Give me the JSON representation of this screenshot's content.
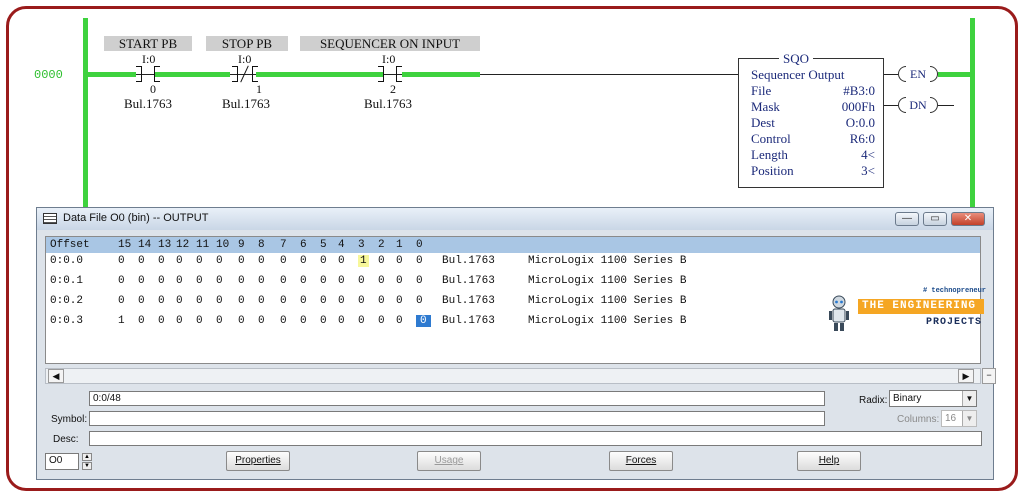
{
  "rung": {
    "number": "0000",
    "instructions": [
      {
        "title": "START PB",
        "address": "I:0",
        "bit": "0",
        "device": "Bul.1763"
      },
      {
        "title": "STOP PB",
        "address": "I:0",
        "bit": "1",
        "device": "Bul.1763"
      },
      {
        "title": "SEQUENCER ON INPUT",
        "address": "I:0",
        "bit": "2",
        "device": "Bul.1763"
      }
    ],
    "sqo": {
      "header": "SQO",
      "title": "Sequencer Output",
      "rows": [
        {
          "key": "File",
          "value": "#B3:0"
        },
        {
          "key": "Mask",
          "value": "000Fh"
        },
        {
          "key": "Dest",
          "value": "O:0.0"
        },
        {
          "key": "Control",
          "value": "R6:0"
        },
        {
          "key": "Length",
          "value": "4<"
        },
        {
          "key": "Position",
          "value": "3<"
        }
      ]
    },
    "coils": {
      "en": "EN",
      "dn": "DN"
    }
  },
  "window": {
    "title": "Data File O0 (bin)  --  OUTPUT",
    "controls": {
      "minimize": "—",
      "restore": "▭",
      "close": "✕"
    },
    "grid": {
      "columns": [
        "Offset",
        "15",
        "14",
        "13",
        "12",
        "11",
        "10",
        "9",
        "8",
        "7",
        "6",
        "5",
        "4",
        "3",
        "2",
        "1",
        "0"
      ],
      "rows": [
        {
          "offset": "0:0.0",
          "bits": [
            "0",
            "0",
            "0",
            "0",
            "0",
            "0",
            "0",
            "0",
            "0",
            "0",
            "0",
            "0",
            "1",
            "0",
            "0",
            "0"
          ],
          "device": "Bul.1763",
          "description": "MicroLogix 1100 Series B"
        },
        {
          "offset": "0:0.1",
          "bits": [
            "0",
            "0",
            "0",
            "0",
            "0",
            "0",
            "0",
            "0",
            "0",
            "0",
            "0",
            "0",
            "0",
            "0",
            "0",
            "0"
          ],
          "device": "Bul.1763",
          "description": "MicroLogix 1100 Series B"
        },
        {
          "offset": "0:0.2",
          "bits": [
            "0",
            "0",
            "0",
            "0",
            "0",
            "0",
            "0",
            "0",
            "0",
            "0",
            "0",
            "0",
            "0",
            "0",
            "0",
            "0"
          ],
          "device": "Bul.1763",
          "description": "MicroLogix 1100 Series B"
        },
        {
          "offset": "0:0.3",
          "bits": [
            "1",
            "0",
            "0",
            "0",
            "0",
            "0",
            "0",
            "0",
            "0",
            "0",
            "0",
            "0",
            "0",
            "0",
            "0",
            "0"
          ],
          "device": "Bul.1763",
          "description": "MicroLogix 1100 Series B"
        }
      ]
    },
    "logo": {
      "tag": "# technopreneur",
      "line1": "THE ENGINEERING",
      "line2": "PROJECTS"
    },
    "address_field": "0:0/48",
    "symbol_label": "Symbol:",
    "desc_label": "Desc:",
    "radix_label": "Radix:",
    "radix_value": "Binary",
    "columns_label": "Columns:",
    "columns_value": "16",
    "file_number": "O0",
    "buttons": {
      "properties": "Properties",
      "usage": "Usage",
      "forces": "Forces",
      "help": "Help"
    }
  },
  "colors": {
    "frame": "#9a1b1b",
    "power": "#3ed23e",
    "selection": "#2e7ad0",
    "highlight": "#f7f79a",
    "header": "#a9c6e4"
  }
}
